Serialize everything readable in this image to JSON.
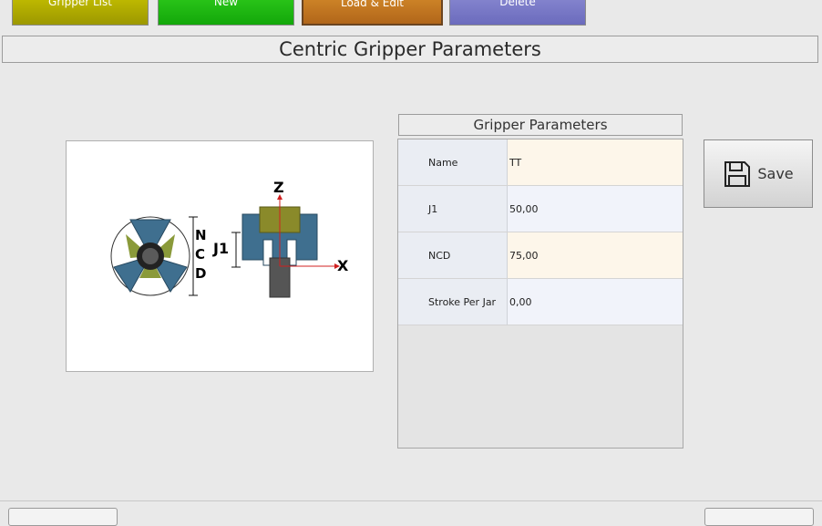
{
  "top_buttons": {
    "gripper_list": "Gripper List",
    "new": "New",
    "load_edit": "Load & Edit",
    "delete": "Delete"
  },
  "page_title": "Centric Gripper Parameters",
  "diagram": {
    "labels": {
      "z": "Z",
      "x": "X",
      "j1": "J1",
      "n": "N",
      "c": "C",
      "d": "D"
    }
  },
  "params_section": {
    "header": "Gripper Parameters",
    "rows": [
      {
        "label": "Name",
        "value": "TT"
      },
      {
        "label": "J1",
        "value": "50,00"
      },
      {
        "label": "NCD",
        "value": "75,00"
      },
      {
        "label": "Stroke Per Jar",
        "value": "0,00"
      }
    ]
  },
  "save": {
    "label": "Save",
    "icon": "floppy-disk-icon"
  }
}
